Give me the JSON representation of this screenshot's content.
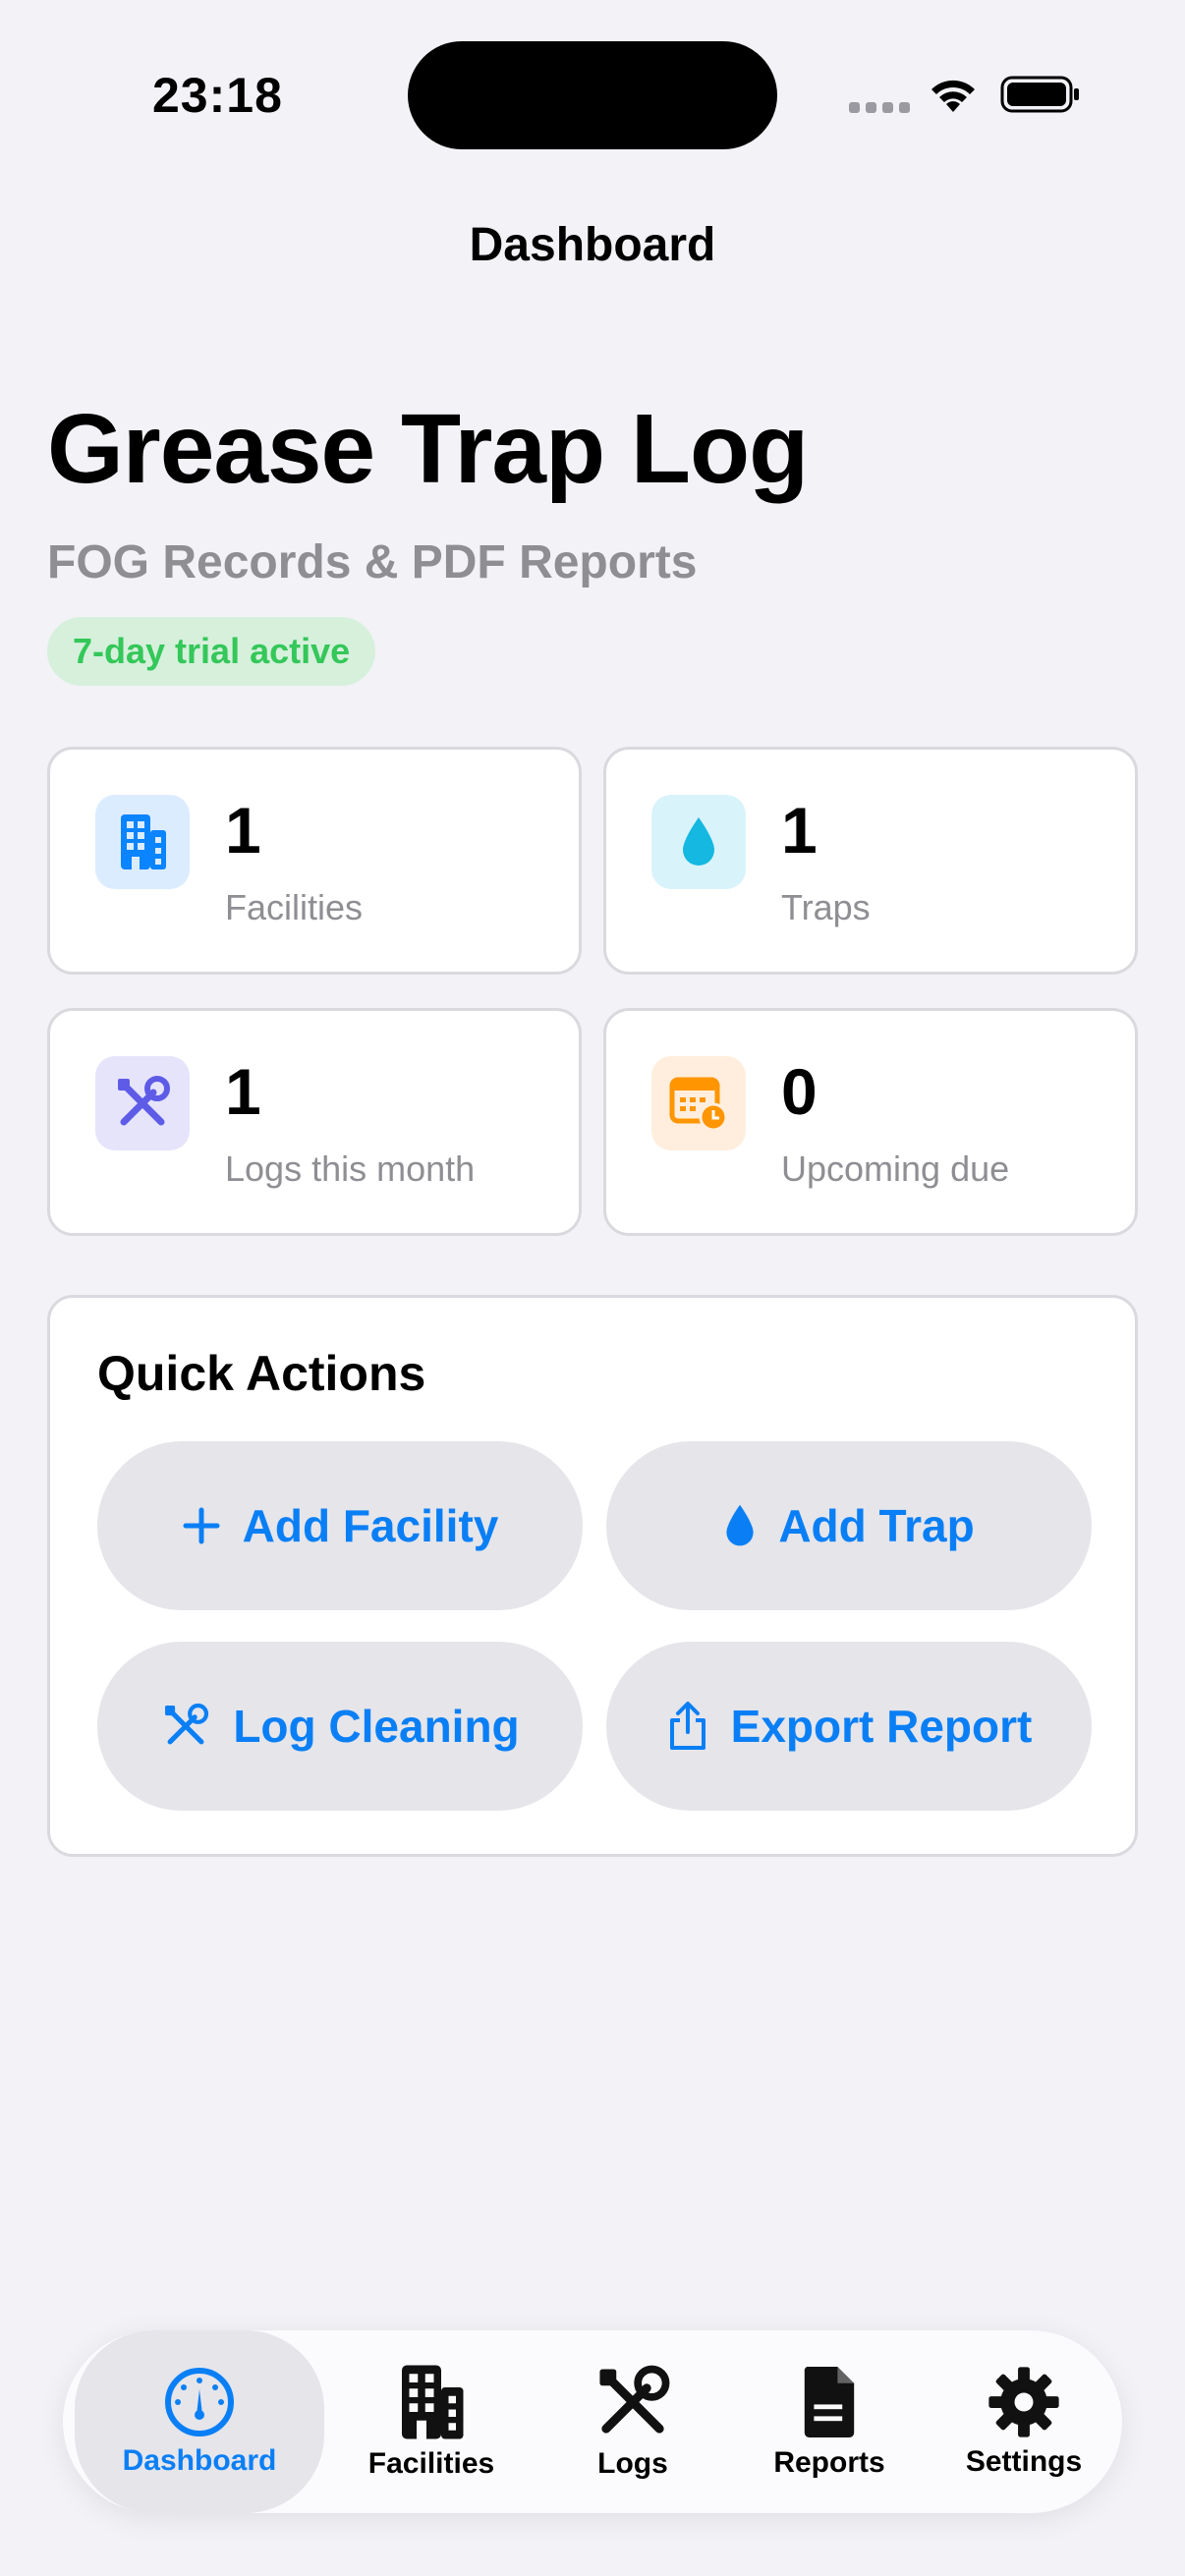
{
  "status_bar": {
    "time": "23:18"
  },
  "nav": {
    "title": "Dashboard"
  },
  "header": {
    "title": "Grease Trap Log",
    "subtitle": "FOG Records & PDF Reports",
    "trial_badge": "7-day trial active"
  },
  "stats": [
    {
      "value": "1",
      "label": "Facilities",
      "icon": "building-icon",
      "color": "#0a84ff"
    },
    {
      "value": "1",
      "label": "Traps",
      "icon": "drop-icon",
      "color": "#14b8e0"
    },
    {
      "value": "1",
      "label": "Logs this month",
      "icon": "wrench-screwdriver-icon",
      "color": "#5e5ce6"
    },
    {
      "value": "0",
      "label": "Upcoming due",
      "icon": "calendar-clock-icon",
      "color": "#ff9500"
    }
  ],
  "quick_actions": {
    "title": "Quick Actions",
    "buttons": [
      {
        "label": "Add Facility",
        "icon": "plus-icon"
      },
      {
        "label": "Add Trap",
        "icon": "drop-icon"
      },
      {
        "label": "Log Cleaning",
        "icon": "wrench-screwdriver-icon"
      },
      {
        "label": "Export Report",
        "icon": "share-icon"
      }
    ]
  },
  "tabs": [
    {
      "label": "Dashboard",
      "icon": "gauge-icon",
      "active": true
    },
    {
      "label": "Facilities",
      "icon": "building-icon",
      "active": false
    },
    {
      "label": "Logs",
      "icon": "wrench-screwdriver-icon",
      "active": false
    },
    {
      "label": "Reports",
      "icon": "document-icon",
      "active": false
    },
    {
      "label": "Settings",
      "icon": "gear-icon",
      "active": false
    }
  ],
  "colors": {
    "accent": "#0a7ff5",
    "trial_green": "#34c759",
    "trial_bg": "#d6f0dc",
    "background": "#f2f2f7"
  }
}
